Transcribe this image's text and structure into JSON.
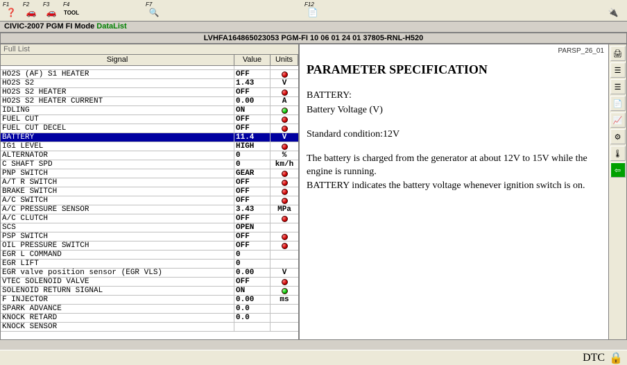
{
  "toolbar": {
    "f1": "F1",
    "f2": "F2",
    "f3": "F3",
    "f4": "F4",
    "f4_label": "TOOL",
    "f7": "F7",
    "f12": "F12"
  },
  "breadcrumb": {
    "model": "CIVIC-2007",
    "sys": "PGM FI",
    "mode": "Mode",
    "screen": "DataList"
  },
  "header": "LVHFA164865023053  PGM-FI  10 06 01 24 01  37805-RNL-H520",
  "list_title": "Full List",
  "columns": {
    "sig": "Signal",
    "val": "Value",
    "unit": "Units"
  },
  "rows": [
    {
      "sig": "HO2S (AF) S1 HEATER",
      "val": "OFF",
      "unit": "",
      "dot": "red"
    },
    {
      "sig": "HO2S S2",
      "val": "1.43",
      "unit": "V",
      "dot": ""
    },
    {
      "sig": "HO2S S2 HEATER",
      "val": "OFF",
      "unit": "",
      "dot": "red"
    },
    {
      "sig": "HO2S S2 HEATER CURRENT",
      "val": "0.00",
      "unit": "A",
      "dot": ""
    },
    {
      "sig": "IDLING",
      "val": "ON",
      "unit": "",
      "dot": "green"
    },
    {
      "sig": "FUEL CUT",
      "val": "OFF",
      "unit": "",
      "dot": "red"
    },
    {
      "sig": "FUEL CUT DECEL",
      "val": "OFF",
      "unit": "",
      "dot": "red"
    },
    {
      "sig": "BATTERY",
      "val": "11.4",
      "unit": "V",
      "dot": "",
      "sel": true
    },
    {
      "sig": "IG1 LEVEL",
      "val": "HIGH",
      "unit": "",
      "dot": "red"
    },
    {
      "sig": "ALTERNATOR",
      "val": "0",
      "unit": "%",
      "dot": ""
    },
    {
      "sig": "C SHAFT SPD",
      "val": "0",
      "unit": "km/h",
      "dot": ""
    },
    {
      "sig": "PNP SWITCH",
      "val": "GEAR",
      "unit": "",
      "dot": "red"
    },
    {
      "sig": "A/T R SWITCH",
      "val": "OFF",
      "unit": "",
      "dot": "red"
    },
    {
      "sig": "BRAKE SWITCH",
      "val": "OFF",
      "unit": "",
      "dot": "red"
    },
    {
      "sig": "A/C SWITCH",
      "val": "OFF",
      "unit": "",
      "dot": "red"
    },
    {
      "sig": "A/C PRESSURE SENSOR",
      "val": "3.43",
      "unit": "MPa",
      "dot": ""
    },
    {
      "sig": "A/C CLUTCH",
      "val": "OFF",
      "unit": "",
      "dot": "red"
    },
    {
      "sig": "SCS",
      "val": "OPEN",
      "unit": "",
      "dot": ""
    },
    {
      "sig": "PSP SWITCH",
      "val": "OFF",
      "unit": "",
      "dot": "red"
    },
    {
      "sig": "OIL PRESSURE SWITCH",
      "val": "OFF",
      "unit": "",
      "dot": "red"
    },
    {
      "sig": "EGR L COMMAND",
      "val": "0",
      "unit": "",
      "dot": ""
    },
    {
      "sig": "EGR LIFT",
      "val": "0",
      "unit": "",
      "dot": ""
    },
    {
      "sig": "EGR valve position sensor (EGR VLS)",
      "val": "0.00",
      "unit": "V",
      "dot": ""
    },
    {
      "sig": "VTEC SOLENOID VALVE",
      "val": "OFF",
      "unit": "",
      "dot": "red"
    },
    {
      "sig": "SOLENOID RETURN SIGNAL",
      "val": "ON",
      "unit": "",
      "dot": "green"
    },
    {
      "sig": "F INJECTOR",
      "val": "0.00",
      "unit": "ms",
      "dot": ""
    },
    {
      "sig": "SPARK ADVANCE",
      "val": "0.0",
      "unit": "",
      "dot": ""
    },
    {
      "sig": "KNOCK RETARD",
      "val": "0.0",
      "unit": "",
      "dot": ""
    },
    {
      "sig": "KNOCK SENSOR",
      "val": "",
      "unit": "",
      "dot": ""
    }
  ],
  "spec": {
    "code": "PARSP_26_01",
    "title": "PARAMETER SPECIFICATION",
    "p1": "BATTERY:",
    "p2": "Battery Voltage (V)",
    "p3": "Standard condition:12V",
    "p4": "The battery is charged from the generator at about 12V to 15V while the engine is running.",
    "p5": "BATTERY indicates the battery voltage whenever ignition switch is on."
  },
  "status": {
    "dtc": "DTC"
  }
}
